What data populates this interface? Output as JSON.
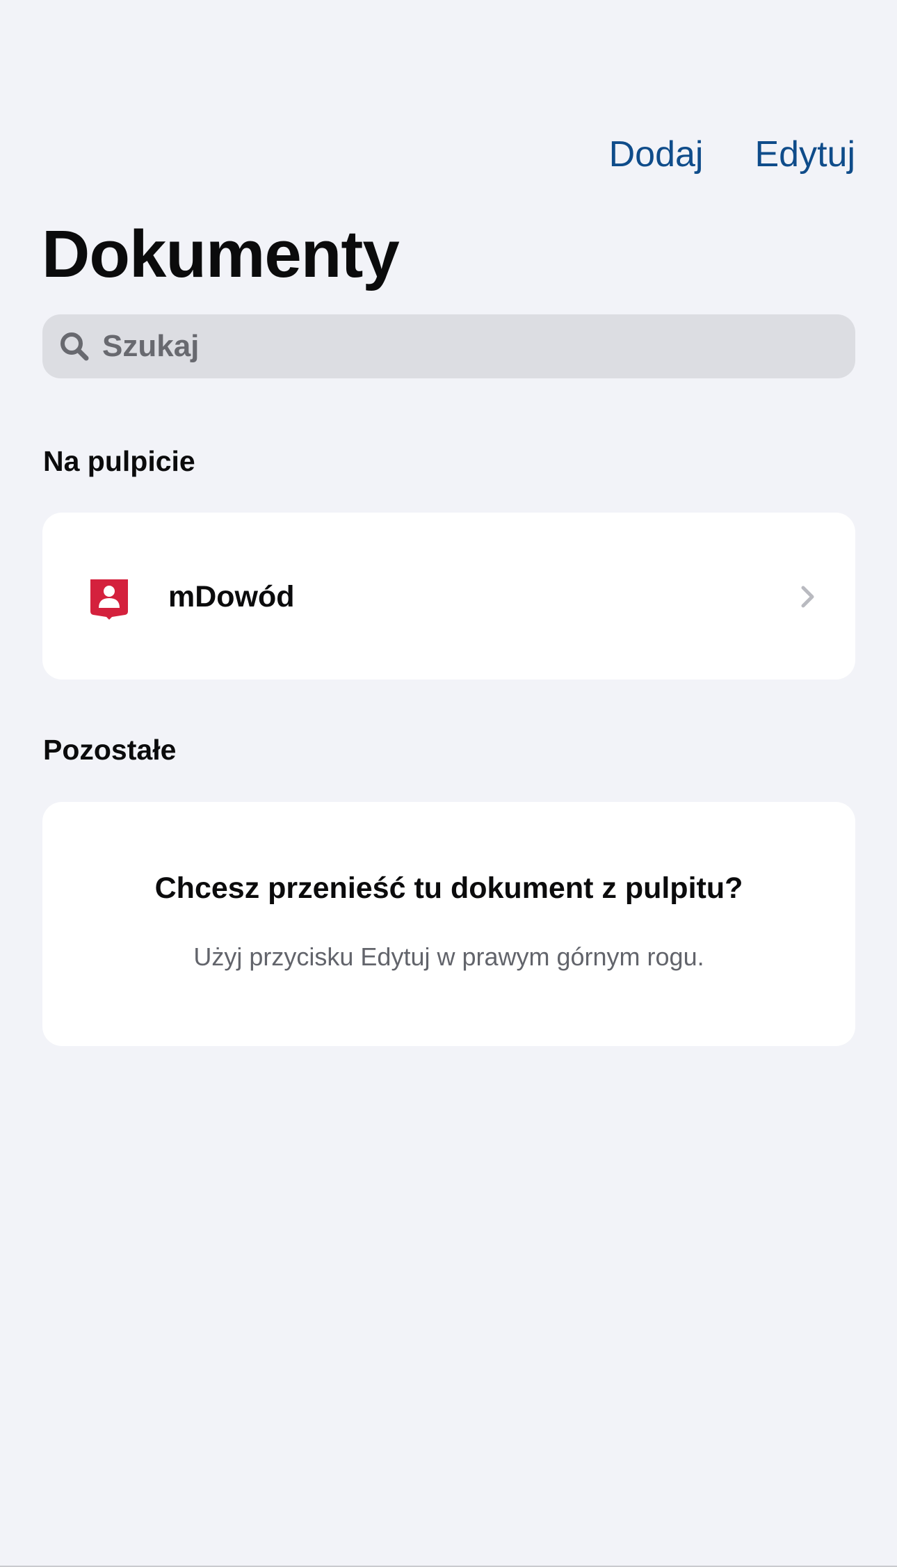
{
  "header": {
    "add_label": "Dodaj",
    "edit_label": "Edytuj",
    "title": "Dokumenty"
  },
  "search": {
    "placeholder": "Szukaj",
    "icon": "search-icon"
  },
  "sections": {
    "desktop": {
      "title": "Na pulpicie",
      "items": [
        {
          "label": "mDowód",
          "icon": "mdowod-id-icon",
          "icon_color": "#d4213d"
        }
      ]
    },
    "other": {
      "title": "Pozostałe",
      "empty_title": "Chcesz przenieść tu dokument z pulpitu?",
      "empty_hint": "Użyj przycisku Edytuj w prawym górnym rogu."
    }
  },
  "colors": {
    "accent": "#0f4c8a",
    "background": "#f2f3f8",
    "card": "#ffffff",
    "search_bg": "#dcdde2"
  }
}
